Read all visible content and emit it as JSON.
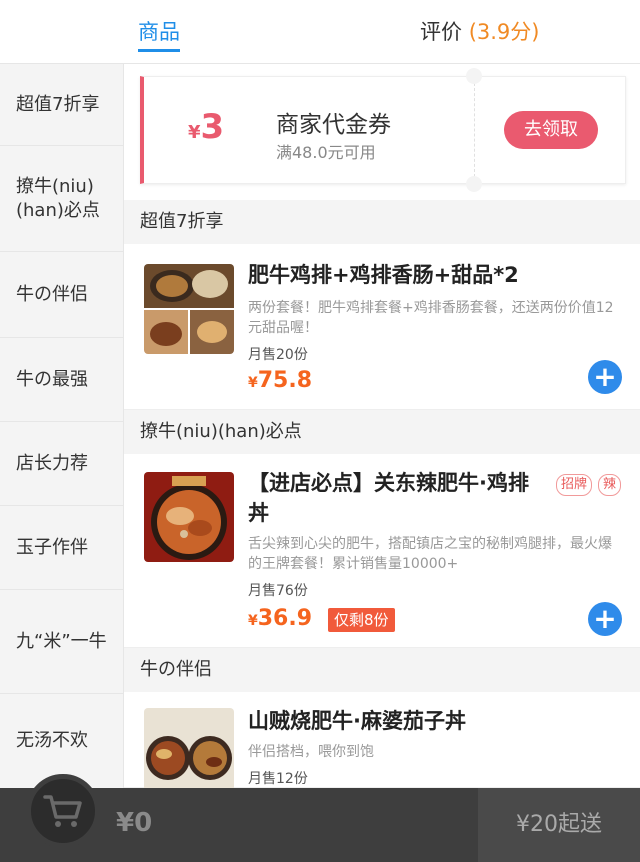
{
  "tabs": {
    "goods": "商品",
    "reviews": "评价",
    "reviews_score": "(3.9分)"
  },
  "sidebar": {
    "items": [
      {
        "label": "超值7折享"
      },
      {
        "label": "撩牛(niu)(han)必点"
      },
      {
        "label": "牛の伴侣"
      },
      {
        "label": "牛の最强"
      },
      {
        "label": "店长力荐"
      },
      {
        "label": "玉子作伴"
      },
      {
        "label": "九“米”一牛"
      },
      {
        "label": "无汤不欢"
      }
    ]
  },
  "coupon": {
    "currency": "¥",
    "amount": "3",
    "title": "商家代金券",
    "condition": "满48.0元可用",
    "button": "去领取"
  },
  "sections": [
    {
      "title": "超值7折享",
      "product": {
        "name": "肥牛鸡排+鸡排香肠+甜品*2",
        "desc": "两份套餐！肥牛鸡排套餐+鸡排香肠套餐，还送两份价值12元甜品喔！",
        "sales": "月售20份",
        "currency": "¥",
        "price": "75.8",
        "add": "+"
      }
    },
    {
      "title": "撩牛(niu)(han)必点",
      "product": {
        "name": "【进店必点】关东辣肥牛·鸡排丼",
        "tags": [
          "招牌",
          "辣"
        ],
        "desc": "舌尖辣到心尖的肥牛，搭配镇店之宝的秘制鸡腿排，最火爆的王牌套餐！累计销售量10000+",
        "sales": "月售76份",
        "currency": "¥",
        "price": "36.9",
        "stock": "仅剩8份",
        "add": "+"
      }
    },
    {
      "title": "牛の伴侣",
      "product": {
        "name": "山贼烧肥牛·麻婆茄子丼",
        "desc": "伴侣搭档，喂你到饱",
        "sales": "月售12份"
      }
    }
  ],
  "cart": {
    "icon": "cart-icon",
    "total": "¥0",
    "min_order": "¥20起送"
  }
}
